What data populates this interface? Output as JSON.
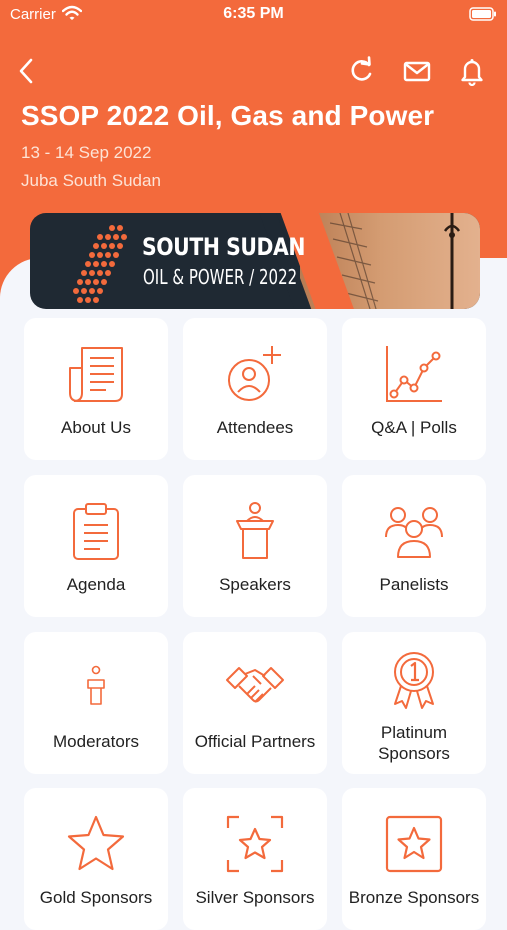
{
  "status_bar": {
    "carrier": "Carrier",
    "time": "6:35 PM"
  },
  "header": {
    "title": "SSOP 2022 Oil, Gas and Power",
    "date": "13 - 14 Sep 2022",
    "location": "Juba South Sudan",
    "buttons": [
      "back-icon",
      "refresh-icon",
      "mail-icon",
      "bell-icon"
    ]
  },
  "banner": {
    "title": "SOUTH SUDAN",
    "subtitle": "OIL & POWER / 2022"
  },
  "accent_color": "#f36a3c",
  "tiles": [
    {
      "label": "About Us",
      "icon": "newspaper-icon"
    },
    {
      "label": "Attendees",
      "icon": "add-user-icon"
    },
    {
      "label": "Q&A | Polls",
      "icon": "line-chart-icon"
    },
    {
      "label": "Agenda",
      "icon": "clipboard-icon"
    },
    {
      "label": "Speakers",
      "icon": "podium-icon"
    },
    {
      "label": "Panelists",
      "icon": "group-icon"
    },
    {
      "label": "Moderators",
      "icon": "moderator-icon"
    },
    {
      "label": "Official Partners",
      "icon": "handshake-icon"
    },
    {
      "label": "Platinum\nSponsors",
      "icon": "award-ribbon-icon"
    },
    {
      "label": "Gold Sponsors",
      "icon": "star-icon"
    },
    {
      "label": "Silver Sponsors",
      "icon": "star-frame-icon"
    },
    {
      "label": "Bronze Sponsors",
      "icon": "star-square-icon"
    }
  ]
}
